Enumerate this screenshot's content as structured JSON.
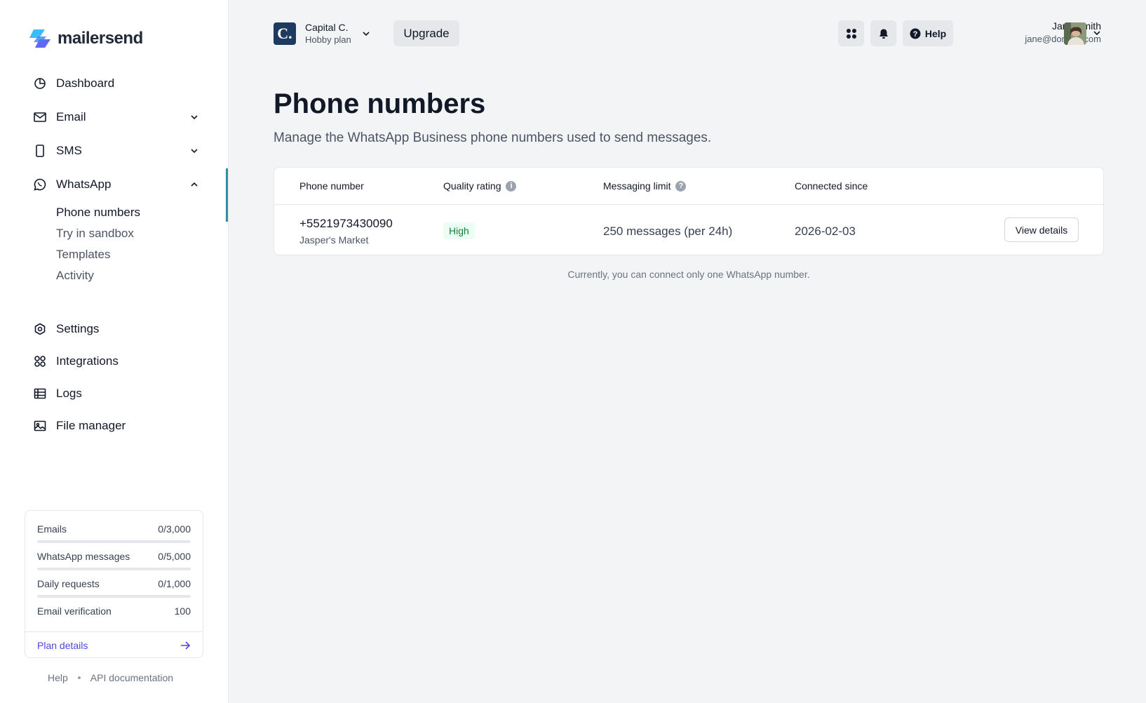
{
  "brand": {
    "name": "mailersend",
    "accent": "#2d8fa8",
    "link_color": "#4f46e5"
  },
  "sidebar": {
    "nav": [
      {
        "label": "Dashboard",
        "icon": "pie-chart-icon"
      },
      {
        "label": "Email",
        "icon": "envelope-icon"
      },
      {
        "label": "SMS",
        "icon": "phone-icon"
      },
      {
        "label": "WhatsApp",
        "icon": "whatsapp-icon"
      }
    ],
    "whatsapp_sub": [
      "Phone numbers",
      "Try in sandbox",
      "Templates",
      "Activity"
    ],
    "nav2": [
      {
        "label": "Settings",
        "icon": "settings-icon"
      },
      {
        "label": "Integrations",
        "icon": "integrations-icon"
      },
      {
        "label": "Logs",
        "icon": "table-icon"
      },
      {
        "label": "File manager",
        "icon": "image-icon"
      }
    ],
    "usage": [
      {
        "label": "Emails",
        "value": "0/3,000",
        "progress": 0
      },
      {
        "label": "WhatsApp messages",
        "value": "0/5,000",
        "progress": 0
      },
      {
        "label": "Daily requests",
        "value": "0/1,000",
        "progress": 0
      },
      {
        "label": "Email verification",
        "value": "100"
      }
    ],
    "plan_details": "Plan details",
    "footer": {
      "help": "Help",
      "api_docs": "API documentation"
    }
  },
  "topbar": {
    "account_initial": "C.",
    "account_name": "Capital C.",
    "account_plan": "Hobby plan",
    "upgrade": "Upgrade",
    "help": "Help",
    "user_name": "Jane Smith",
    "user_email": "jane@domain.com"
  },
  "main": {
    "title": "Phone numbers",
    "description": "Manage the WhatsApp Business phone numbers used to send messages.",
    "table": {
      "headers": [
        "Phone number",
        "Quality rating",
        "Messaging limit",
        "Connected since"
      ],
      "row": {
        "phone": "+5521973430090",
        "company": "Jasper's Market",
        "quality": "High",
        "limit": "250 messages (per 24h)",
        "connected": "2026-02-03",
        "action": "View details"
      }
    },
    "note": "Currently, you can connect only one WhatsApp number."
  }
}
